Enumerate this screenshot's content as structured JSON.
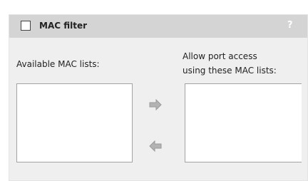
{
  "header": {
    "title": "MAC filter",
    "help": "?"
  },
  "available": {
    "label": "Available MAC lists:",
    "items": []
  },
  "allowed": {
    "label_line1": "Allow port access",
    "label_line2": "using these MAC lists:",
    "items": []
  },
  "icons": {
    "add": "arrow-right-icon",
    "remove": "arrow-left-icon"
  },
  "colors": {
    "header_bg": "#d4d4d4",
    "panel_bg": "#efefef",
    "arrow": "#b3b3b3"
  }
}
